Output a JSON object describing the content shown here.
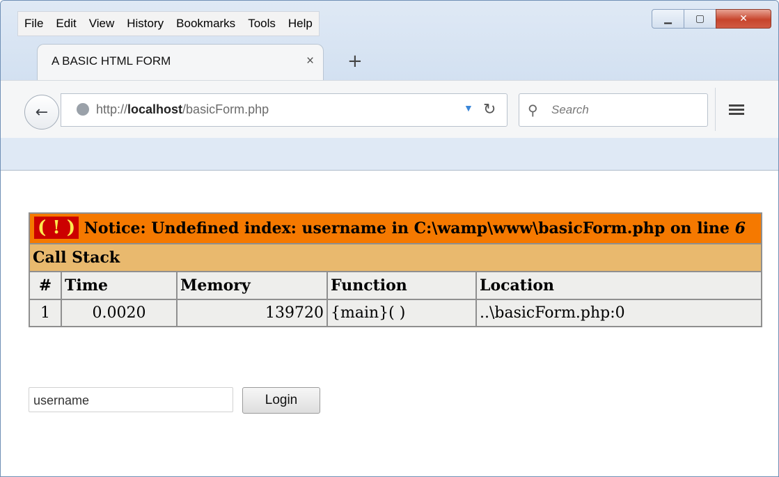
{
  "menu": [
    "File",
    "Edit",
    "View",
    "History",
    "Bookmarks",
    "Tools",
    "Help"
  ],
  "tab": {
    "title": "A BASIC HTML FORM",
    "close": "×",
    "new_tab": "+"
  },
  "navbar": {
    "url_prefix": "http://",
    "url_host": "localhost",
    "url_path": "/basicForm.php",
    "search_placeholder": "Search"
  },
  "notice": {
    "icon": "( ! )",
    "message": "Notice: Undefined index: username in C:\\wamp\\www\\basicForm.php on line",
    "line": "6"
  },
  "call_stack": {
    "title": "Call Stack",
    "headers": [
      "#",
      "Time",
      "Memory",
      "Function",
      "Location"
    ],
    "rows": [
      [
        "1",
        "0.0020",
        "139720",
        "{main}( )",
        "..\\basicForm.php:0"
      ]
    ]
  },
  "form": {
    "username_value": "username",
    "login_label": "Login"
  },
  "colors": {
    "notice_bg": "#f57900",
    "icon_bg": "#cc0000",
    "callstack_bg": "#e9b96e",
    "cell_bg": "#eeeeec",
    "close_button": "#c7442c"
  },
  "icons": {
    "back": "back-arrow-icon",
    "globe": "globe-icon",
    "reload": "reload-icon",
    "search": "search-icon",
    "menu": "hamburger-icon"
  }
}
